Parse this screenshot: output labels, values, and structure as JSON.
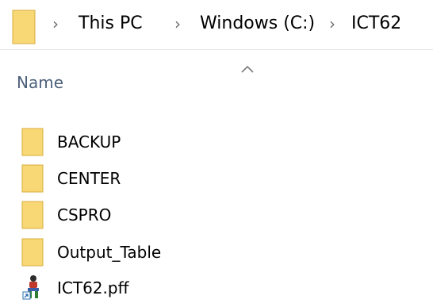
{
  "breadcrumb": {
    "items": [
      "This PC",
      "Windows (C:)",
      "ICT62"
    ],
    "separator": "›"
  },
  "column_header": {
    "name_label": "Name",
    "sort": "ascending"
  },
  "files": [
    {
      "name": "BACKUP",
      "icon": "folder-icon"
    },
    {
      "name": "CENTER",
      "icon": "folder-icon"
    },
    {
      "name": "CSPRO",
      "icon": "folder-icon"
    },
    {
      "name": "Output_Table",
      "icon": "folder-icon"
    },
    {
      "name": "ICT62.pff",
      "icon": "pff-file-icon"
    }
  ],
  "colors": {
    "folder": "#f8d775",
    "folder_edge": "#d9ae3b",
    "header_text": "#4c607a",
    "separator": "#6d6d6d"
  }
}
